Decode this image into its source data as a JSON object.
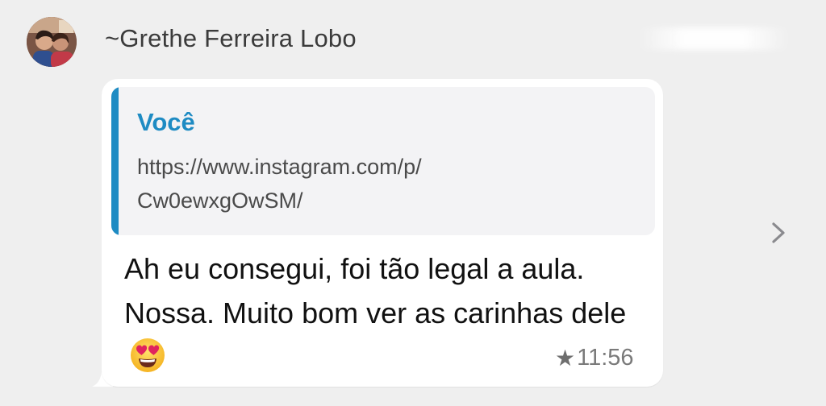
{
  "sender": {
    "name": "~Grethe Ferreira Lobo"
  },
  "message": {
    "quoted": {
      "author": "Você",
      "text": "https://www.instagram.com/p/\nCw0ewxgOwSM/"
    },
    "text": "Ah eu consegui, foi tão legal a aula. Nossa. Muito bom ver as carinhas dele",
    "emoji": "smiling-face-with-heart-eyes",
    "time": "11:56",
    "starred": true
  },
  "icons": {
    "star": "star-icon",
    "chevron": "chevron-right-icon"
  },
  "colors": {
    "background": "#efefef",
    "bubble": "#ffffff",
    "quote_background": "#f3f3f5",
    "quote_accent": "#1e8bc3",
    "message_text": "#111111",
    "meta_text": "#7a7a7a"
  }
}
